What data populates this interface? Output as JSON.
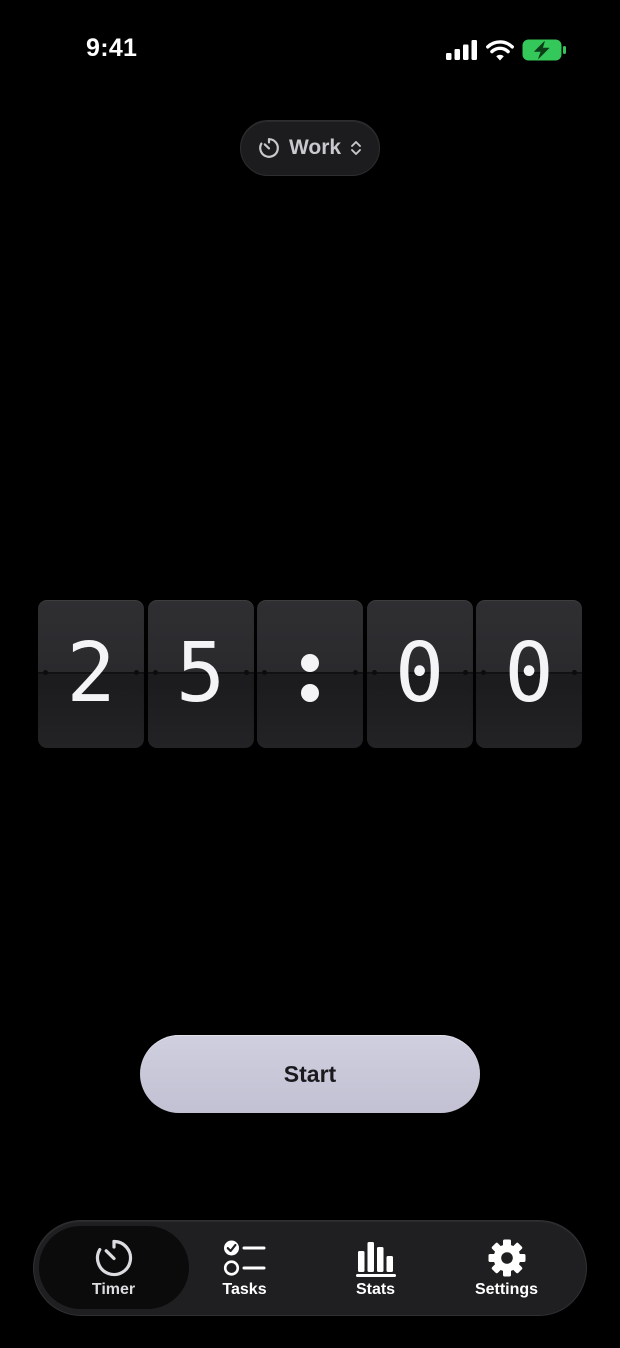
{
  "status_bar": {
    "time": "9:41",
    "icons": [
      "cellular-signal-icon",
      "wifi-icon",
      "battery-charging-icon"
    ],
    "battery_color": "#34c759"
  },
  "mode_selector": {
    "icon": "timer-icon",
    "label": "Work",
    "chevron": "chevron-up-down-icon"
  },
  "timer": {
    "display": "25:00",
    "digits": [
      "2",
      "5",
      ":",
      "0",
      "0"
    ]
  },
  "start_button": {
    "label": "Start",
    "color": "#c7c6d9"
  },
  "tab_bar": {
    "active": "Timer",
    "items": [
      {
        "label": "Timer",
        "icon": "timer-icon"
      },
      {
        "label": "Tasks",
        "icon": "checklist-icon"
      },
      {
        "label": "Stats",
        "icon": "bar-chart-icon"
      },
      {
        "label": "Settings",
        "icon": "gear-icon"
      }
    ]
  }
}
